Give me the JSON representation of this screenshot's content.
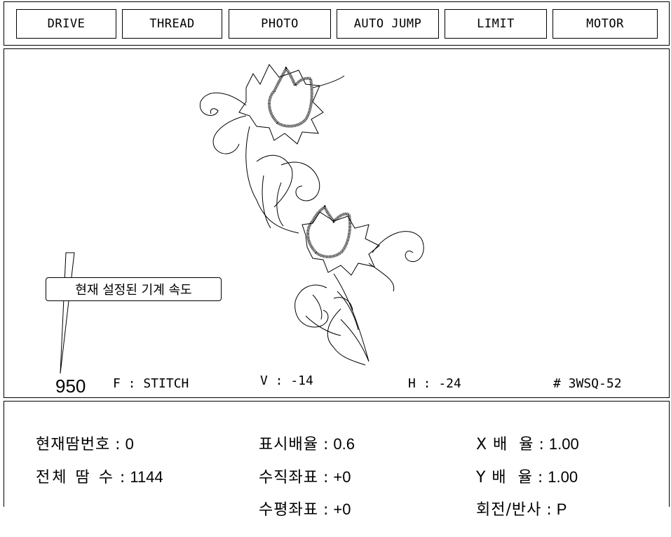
{
  "toolbar": {
    "tabs": [
      "DRIVE",
      "THREAD",
      "PHOTO",
      "AUTO JUMP",
      "LIMIT",
      "MOTOR"
    ]
  },
  "canvas": {
    "callout_text": "현재 설정된 기계 속도",
    "speed": "950",
    "status": {
      "f": "F : STITCH",
      "v": "V : -14",
      "h": "H : -24",
      "design": "# 3WSQ-52"
    }
  },
  "info": {
    "current_stitch": {
      "label": "현재땀번호",
      "sep": " : ",
      "value": "0"
    },
    "total_stitches": {
      "label": "전체 땀 수",
      "sep": " : ",
      "value": "1144"
    },
    "display_scale": {
      "label": "표시배율",
      "sep": " : ",
      "value": "0.6"
    },
    "vertical_coord": {
      "label": "수직좌표",
      "sep": " : ",
      "value": "+0"
    },
    "horizontal_coord": {
      "label": "수평좌표",
      "sep": " : ",
      "value": "+0"
    },
    "x_scale": {
      "label": "X 배  율",
      "sep": " : ",
      "value": "1.00"
    },
    "y_scale": {
      "label": "Y 배  율",
      "sep": " : ",
      "value": "1.00"
    },
    "rotate_mirror": {
      "label": "회전/반사",
      "sep": " : ",
      "value": "P"
    }
  },
  "colors": {
    "line": "#000000",
    "background": "#ffffff"
  }
}
